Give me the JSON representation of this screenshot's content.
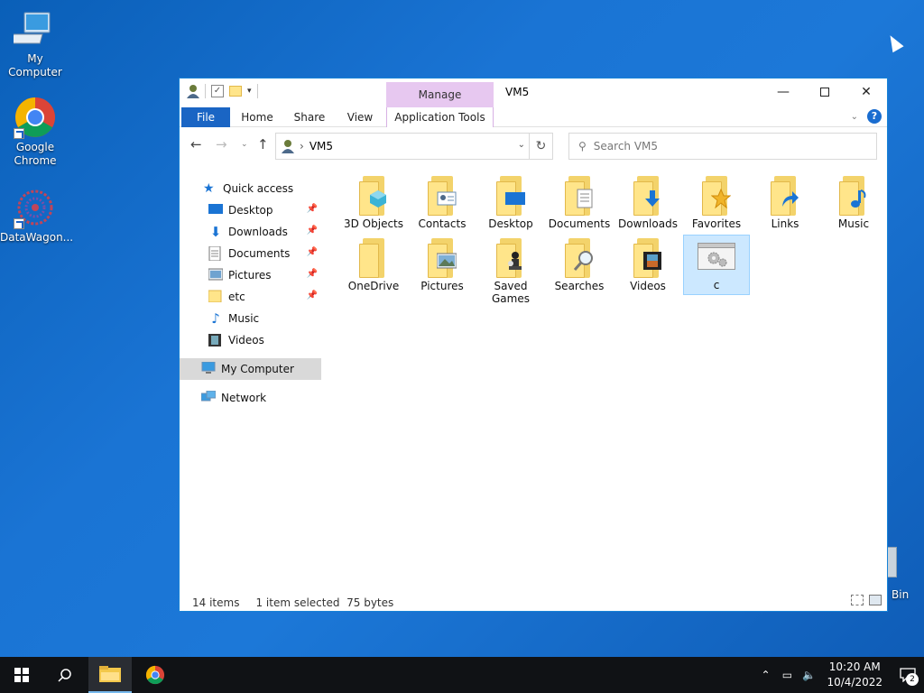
{
  "desktop": {
    "icons": [
      {
        "label": "My Computer",
        "icon": "computer-icon"
      },
      {
        "label": "Google Chrome",
        "icon": "chrome-icon"
      },
      {
        "label": "DataWagon...",
        "icon": "datawagon-icon"
      }
    ],
    "recycle_bin_partial_label": "Bin"
  },
  "window": {
    "title": "VM5",
    "context_tab": "Manage",
    "ribbon_tabs": [
      "File",
      "Home",
      "Share",
      "View",
      "Application Tools"
    ],
    "help_label": "?",
    "address": {
      "path": "VM5",
      "separator": "›"
    },
    "search": {
      "placeholder": "Search VM5"
    },
    "nav": {
      "quick_access": "Quick access",
      "quick_items": [
        {
          "label": "Desktop",
          "icon": "desktop-icon"
        },
        {
          "label": "Downloads",
          "icon": "downloads-icon"
        },
        {
          "label": "Documents",
          "icon": "documents-icon"
        },
        {
          "label": "Pictures",
          "icon": "pictures-icon"
        },
        {
          "label": "etc",
          "icon": "folder-icon"
        },
        {
          "label": "Music",
          "icon": "music-icon"
        },
        {
          "label": "Videos",
          "icon": "videos-icon"
        }
      ],
      "my_computer": "My Computer",
      "network": "Network"
    },
    "items": [
      {
        "label": "3D Objects",
        "icon": "3d-objects-icon"
      },
      {
        "label": "Contacts",
        "icon": "contacts-icon"
      },
      {
        "label": "Desktop",
        "icon": "desktop-icon"
      },
      {
        "label": "Documents",
        "icon": "documents-icon"
      },
      {
        "label": "Downloads",
        "icon": "downloads-icon"
      },
      {
        "label": "Favorites",
        "icon": "favorites-icon"
      },
      {
        "label": "Links",
        "icon": "links-icon"
      },
      {
        "label": "Music",
        "icon": "music-icon"
      },
      {
        "label": "OneDrive",
        "icon": "onedrive-icon"
      },
      {
        "label": "Pictures",
        "icon": "pictures-icon"
      },
      {
        "label": "Saved Games",
        "icon": "saved-games-icon"
      },
      {
        "label": "Searches",
        "icon": "searches-icon"
      },
      {
        "label": "Videos",
        "icon": "videos-icon"
      },
      {
        "label": "c",
        "icon": "settings-file-icon",
        "selected": true
      }
    ],
    "status": {
      "count": "14 items",
      "selection": "1 item selected",
      "size": "75 bytes"
    }
  },
  "taskbar": {
    "time": "10:20 AM",
    "date": "10/4/2022",
    "notification_count": "2"
  },
  "colors": {
    "accent": "#1a65c4",
    "manage_tab": "#e7c8f0",
    "selected_item": "#cce8ff",
    "folder": "#ffe58a"
  }
}
